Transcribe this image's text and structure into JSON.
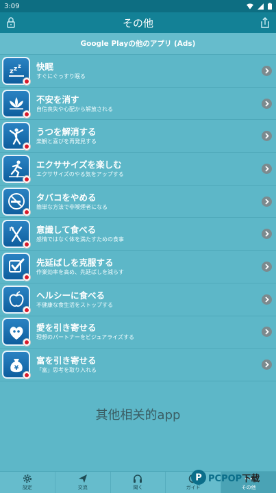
{
  "status_bar": {
    "time": "3:09"
  },
  "header": {
    "title": "その他"
  },
  "section": {
    "title": "Google Playの他のアプリ (Ads)"
  },
  "apps": [
    {
      "title": "快眠",
      "subtitle": "すぐにぐっすり眠る",
      "icon": "sleep-zzz-icon"
    },
    {
      "title": "不安を消す",
      "subtitle": "自信喪失や心配から解放される",
      "icon": "lotus-icon"
    },
    {
      "title": "うつを解消する",
      "subtitle": "楽観と喜びを再発見する",
      "icon": "jumping-person-icon"
    },
    {
      "title": "エクササイズを楽しむ",
      "subtitle": "エクササイズのやる気をアップする",
      "icon": "running-person-icon"
    },
    {
      "title": "タバコをやめる",
      "subtitle": "簡単な方法で非喫煙者になる",
      "icon": "no-smoking-icon"
    },
    {
      "title": "意識して食べる",
      "subtitle": "感情ではなく体を満たすための食事",
      "icon": "fork-knife-icon"
    },
    {
      "title": "先延ばしを克服する",
      "subtitle": "作業効率を高め、先延ばしを減らす",
      "icon": "checkbox-icon"
    },
    {
      "title": "ヘルシーに食べる",
      "subtitle": "不健康な食生活をストップする",
      "icon": "apple-icon"
    },
    {
      "title": "愛を引き寄せる",
      "subtitle": "理想のパートナーをビジュアライズする",
      "icon": "heart-people-icon"
    },
    {
      "title": "富を引き寄せる",
      "subtitle": "「富」思考を取り入れる",
      "icon": "money-bag-icon"
    }
  ],
  "footer_text": "其他相关的app",
  "bottom_nav": [
    {
      "label": "設定",
      "icon": "gear-icon"
    },
    {
      "label": "交流",
      "icon": "send-icon"
    },
    {
      "label": "聞く",
      "icon": "headphones-icon"
    },
    {
      "label": "ガイド",
      "icon": "guide-icon"
    },
    {
      "label": "その他",
      "icon": "more-icon"
    }
  ],
  "watermark": {
    "brand": "PCPOP",
    "suffix": "下载"
  },
  "colors": {
    "status_bar": "#0d6e82",
    "app_bar": "#138196",
    "background": "#5db7c8",
    "icon_blue": "#1a72b4",
    "badge_red": "#d81b2a"
  }
}
